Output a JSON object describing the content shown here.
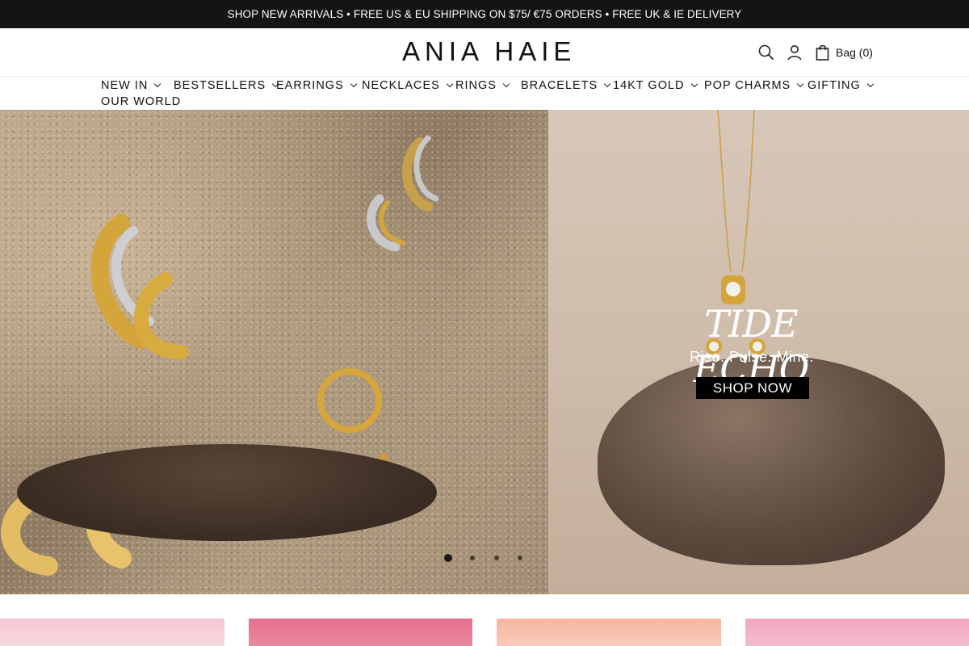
{
  "announcement": "SHOP NEW ARRIVALS • FREE US & EU SHIPPING ON $75/ €75 ORDERS • FREE UK & IE DELIVERY",
  "header": {
    "logo": "ANIA HAIE",
    "bag_label": "Bag (0)",
    "icons": [
      "search-icon",
      "account-icon",
      "bag-icon"
    ]
  },
  "nav": {
    "items": [
      {
        "label": "NEW IN"
      },
      {
        "label": "BESTSELLERS"
      },
      {
        "label": "EARRINGS"
      },
      {
        "label": "NECKLACES"
      },
      {
        "label": "RINGS"
      },
      {
        "label": "BRACELETS"
      },
      {
        "label": "14KT GOLD"
      },
      {
        "label": "POP CHARMS"
      },
      {
        "label": "GIFTING"
      },
      {
        "label": "OUR WORLD"
      }
    ]
  },
  "hero": {
    "title": "TIDE ECHO",
    "subtitle": "Rise. Pulse. Mine.",
    "cta": "SHOP NOW",
    "slides": 4,
    "active_slide": 1
  },
  "colors": {
    "announcement_bg": "#141414",
    "cta_bg": "#000000",
    "text": "#111111"
  }
}
